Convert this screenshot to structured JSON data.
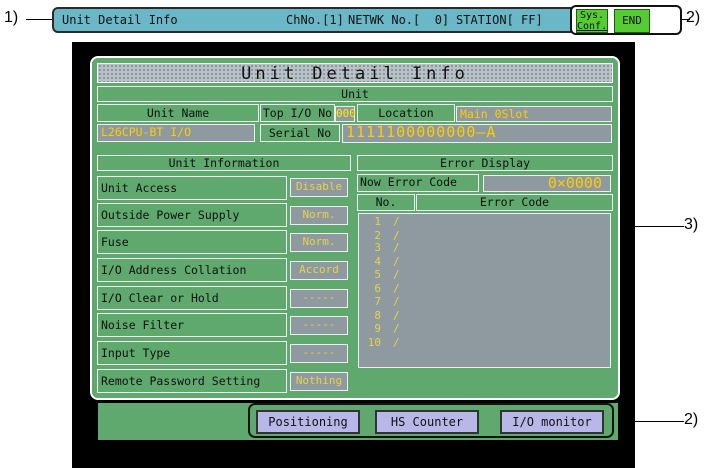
{
  "callouts": {
    "c1": "1)",
    "c2a": "2)",
    "c3": "3)",
    "c2b": "2)"
  },
  "topbar": {
    "title": "Unit Detail Info",
    "chno": "ChNo.[1]",
    "netwk": "NETWK No.[  0]",
    "station": "STATION[ FF]",
    "sysconf": [
      "Sys.",
      "Conf."
    ],
    "end": "END"
  },
  "panel": {
    "title": "Unit Detail Info",
    "unit_header": "Unit",
    "unit_name_label": "Unit Name",
    "unit_name_value": "L26CPU-BT I/O",
    "top_io_label": "Top I/O No",
    "top_io_value": "000",
    "location_label": "Location",
    "location_value": "Main  0Slot",
    "serial_label": "Serial No",
    "serial_value": "1111100000000—A",
    "unit_info_header": "Unit Information",
    "rows": [
      {
        "label": "Unit Access",
        "value": "Disable"
      },
      {
        "label": "Outside Power Supply",
        "value": "Norm."
      },
      {
        "label": "Fuse",
        "value": "Norm."
      },
      {
        "label": "I/O Address Collation",
        "value": "Accord"
      },
      {
        "label": "I/O Clear or Hold",
        "value": "-----"
      },
      {
        "label": "Noise Filter",
        "value": "-----"
      },
      {
        "label": "Input Type",
        "value": "-----"
      },
      {
        "label": "Remote Password Setting",
        "value": "Nothing"
      }
    ],
    "error_display_header": "Error Display",
    "now_error_label": "Now Error Code",
    "now_error_value": "0×0000",
    "no_header": "No.",
    "error_code_header": "Error Code",
    "errors": [
      "1",
      "2",
      "3",
      "4",
      "5",
      "6",
      "7",
      "8",
      "9",
      "10"
    ],
    "error_sep": "/"
  },
  "bottom": {
    "positioning": "Positioning",
    "hs_counter": "HS Counter",
    "io_monitor": "I/O monitor"
  },
  "colors": {
    "panel_green": "#5fa86e",
    "topbar_cyan": "#6ab7c8",
    "value_gray": "#8e9aa0",
    "value_text": "#e8d24a",
    "button_lavender": "#b8b8e8",
    "button_green": "#55cc33"
  }
}
